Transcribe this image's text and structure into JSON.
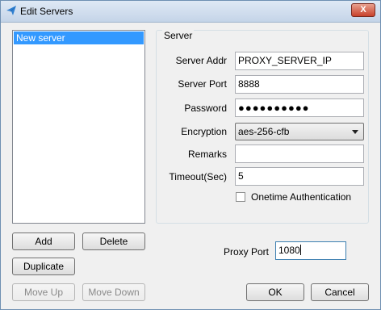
{
  "window": {
    "title": "Edit Servers",
    "close_label": "X"
  },
  "server_list": {
    "items": [
      "New server"
    ]
  },
  "server_group": {
    "label": "Server",
    "fields": {
      "server_addr": {
        "label": "Server Addr",
        "value": "PROXY_SERVER_IP"
      },
      "server_port": {
        "label": "Server Port",
        "value": "8888"
      },
      "password": {
        "label": "Password",
        "value": "●●●●●●●●●●"
      },
      "encryption": {
        "label": "Encryption",
        "value": "aes-256-cfb"
      },
      "remarks": {
        "label": "Remarks",
        "value": ""
      },
      "timeout": {
        "label": "Timeout(Sec)",
        "value": "5"
      }
    },
    "onetime_auth": {
      "label": "Onetime Authentication",
      "checked": false
    }
  },
  "buttons": {
    "add": "Add",
    "delete": "Delete",
    "duplicate": "Duplicate",
    "move_up": "Move Up",
    "move_down": "Move Down",
    "ok": "OK",
    "cancel": "Cancel"
  },
  "proxy_port": {
    "label": "Proxy Port",
    "value": "1080"
  },
  "colors": {
    "selection": "#3399ff",
    "title_gradient_top": "#dfe9f5",
    "close_red": "#c8412b"
  }
}
